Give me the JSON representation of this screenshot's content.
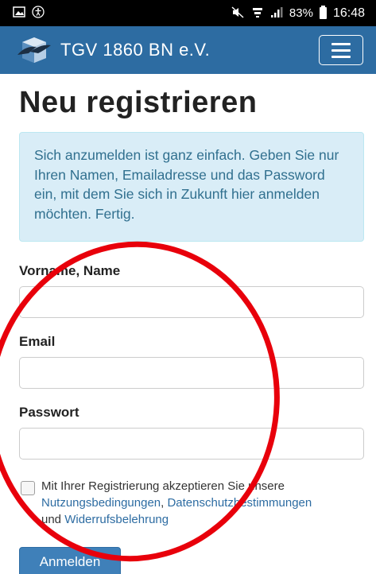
{
  "status_bar": {
    "left_icons": [
      "image-icon",
      "accessibility-icon"
    ],
    "right_icons": [
      "mute-icon",
      "wifi-icon",
      "signal-icon"
    ],
    "battery_percent": "83%",
    "time": "16:48"
  },
  "navbar": {
    "brand_name": "TGV 1860 BN e.V.",
    "menu_icon": "hamburger-icon"
  },
  "page": {
    "title": "Neu registrieren",
    "info_text": "Sich anzumelden ist ganz einfach. Geben Sie nur Ihren Namen, Emailadresse und das Password ein, mit dem Sie sich in Zukunft hier anmelden möchten. Fertig."
  },
  "form": {
    "name_label": "Vorname, Name",
    "name_value": "",
    "email_label": "Email",
    "email_value": "",
    "password_label": "Passwort",
    "password_value": "",
    "terms": {
      "checked": false,
      "prefix": "Mit Ihrer Registrierung akzeptieren Sie unsere",
      "link_terms": "Nutzungsbedingungen",
      "separator": ", ",
      "link_privacy": "Datenschutzbestimmungen",
      "and_word": "und",
      "link_withdrawal": "Widerrufsbelehrung"
    },
    "submit_label": "Anmelden"
  },
  "colors": {
    "navbar": "#2d6ca2",
    "info_background": "#d9edf7",
    "info_text": "#31708f",
    "link": "#2d6ca2",
    "button": "#3f80b9",
    "annotation": "#e8000b"
  }
}
